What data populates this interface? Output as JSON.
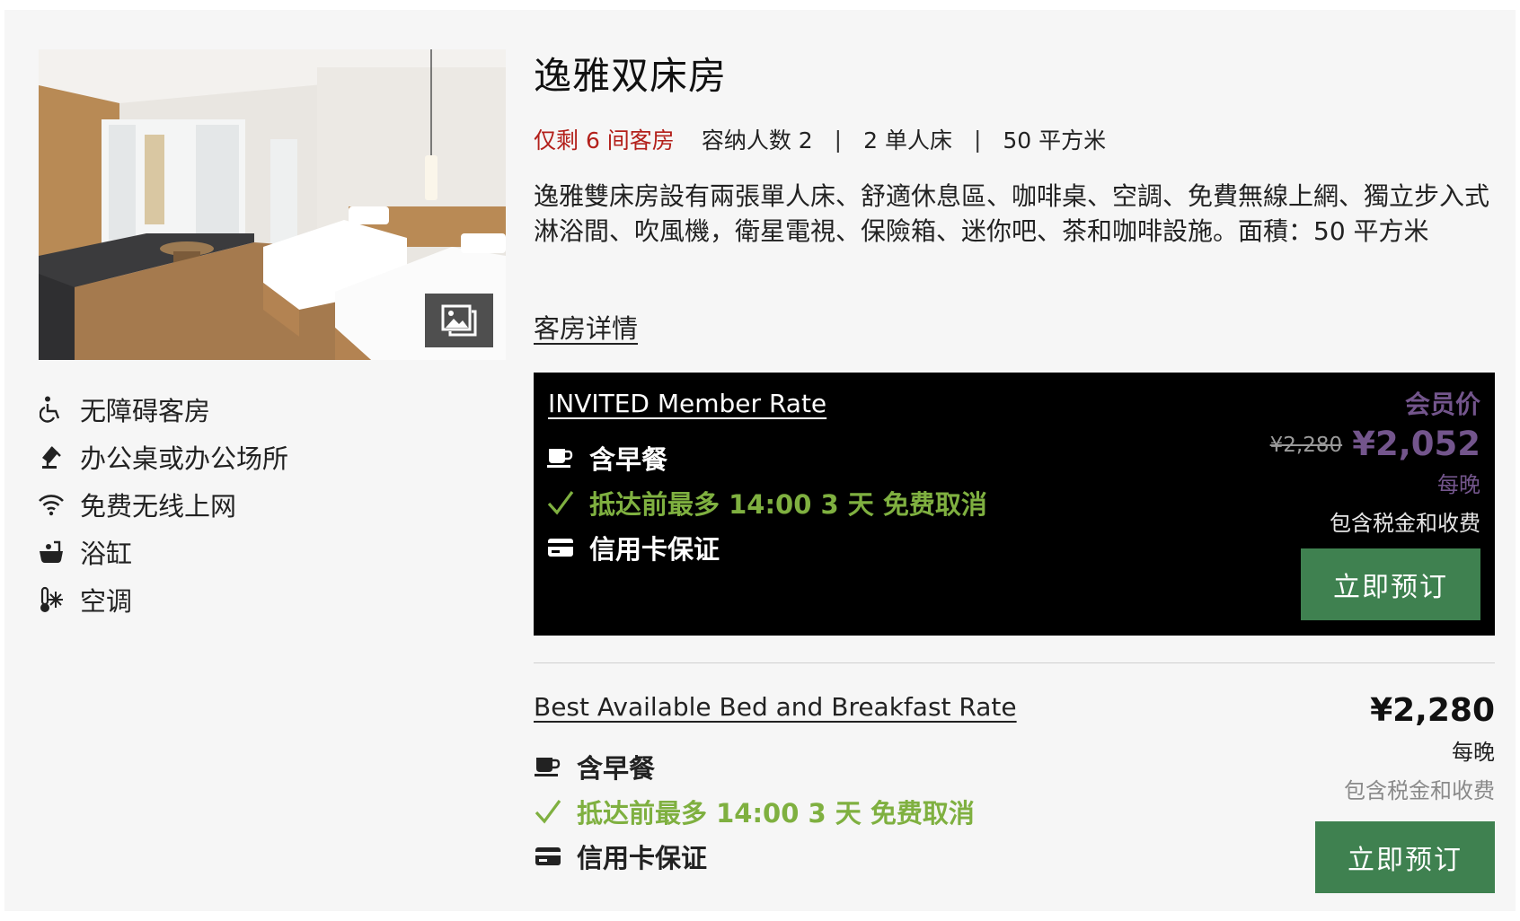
{
  "room": {
    "title": "逸雅双床房",
    "availability": "仅剩 6 间客房",
    "capacity": "容纳人数 2",
    "beds": "2 单人床",
    "size": "50 平方米",
    "separator": "|",
    "description": "逸雅雙床房設有兩張單人床、舒適休息區、咖啡桌、空調、免費無線上網、獨立步入式淋浴間、吹風機，衛星電視、保險箱、迷你吧、茶和咖啡設施。面積：50 平方米",
    "details_link": "客房详情"
  },
  "amenities": [
    {
      "icon": "wheelchair-icon",
      "label": "无障碍客房"
    },
    {
      "icon": "desk-lamp-icon",
      "label": "办公桌或办公场所"
    },
    {
      "icon": "wifi-icon",
      "label": "免费无线上网"
    },
    {
      "icon": "bathtub-icon",
      "label": "浴缸"
    },
    {
      "icon": "thermometer-snowflake-icon",
      "label": "空调"
    }
  ],
  "rates": [
    {
      "name": "INVITED Member Rate",
      "breakfast": "含早餐",
      "cancellation": "抵达前最多 14:00 3 天 免费取消",
      "guarantee": "信用卡保证",
      "member_label": "会员价",
      "original_price": "¥2,280",
      "price": "¥2,052",
      "per_night": "每晚",
      "tax_note": "包含税金和收费",
      "book_label": "立即预订"
    },
    {
      "name": "Best Available Bed and Breakfast Rate",
      "breakfast": "含早餐",
      "cancellation": "抵达前最多 14:00 3 天 免费取消",
      "guarantee": "信用卡保证",
      "price": "¥2,280",
      "per_night": "每晚",
      "tax_note": "包含税金和收费",
      "book_label": "立即预订"
    }
  ],
  "colors": {
    "availability_red": "#b3201b",
    "member_purple": "#73558c",
    "cancel_green": "#7fb040",
    "button_green": "#3f8150",
    "rate_dark_bg": "#000000"
  }
}
